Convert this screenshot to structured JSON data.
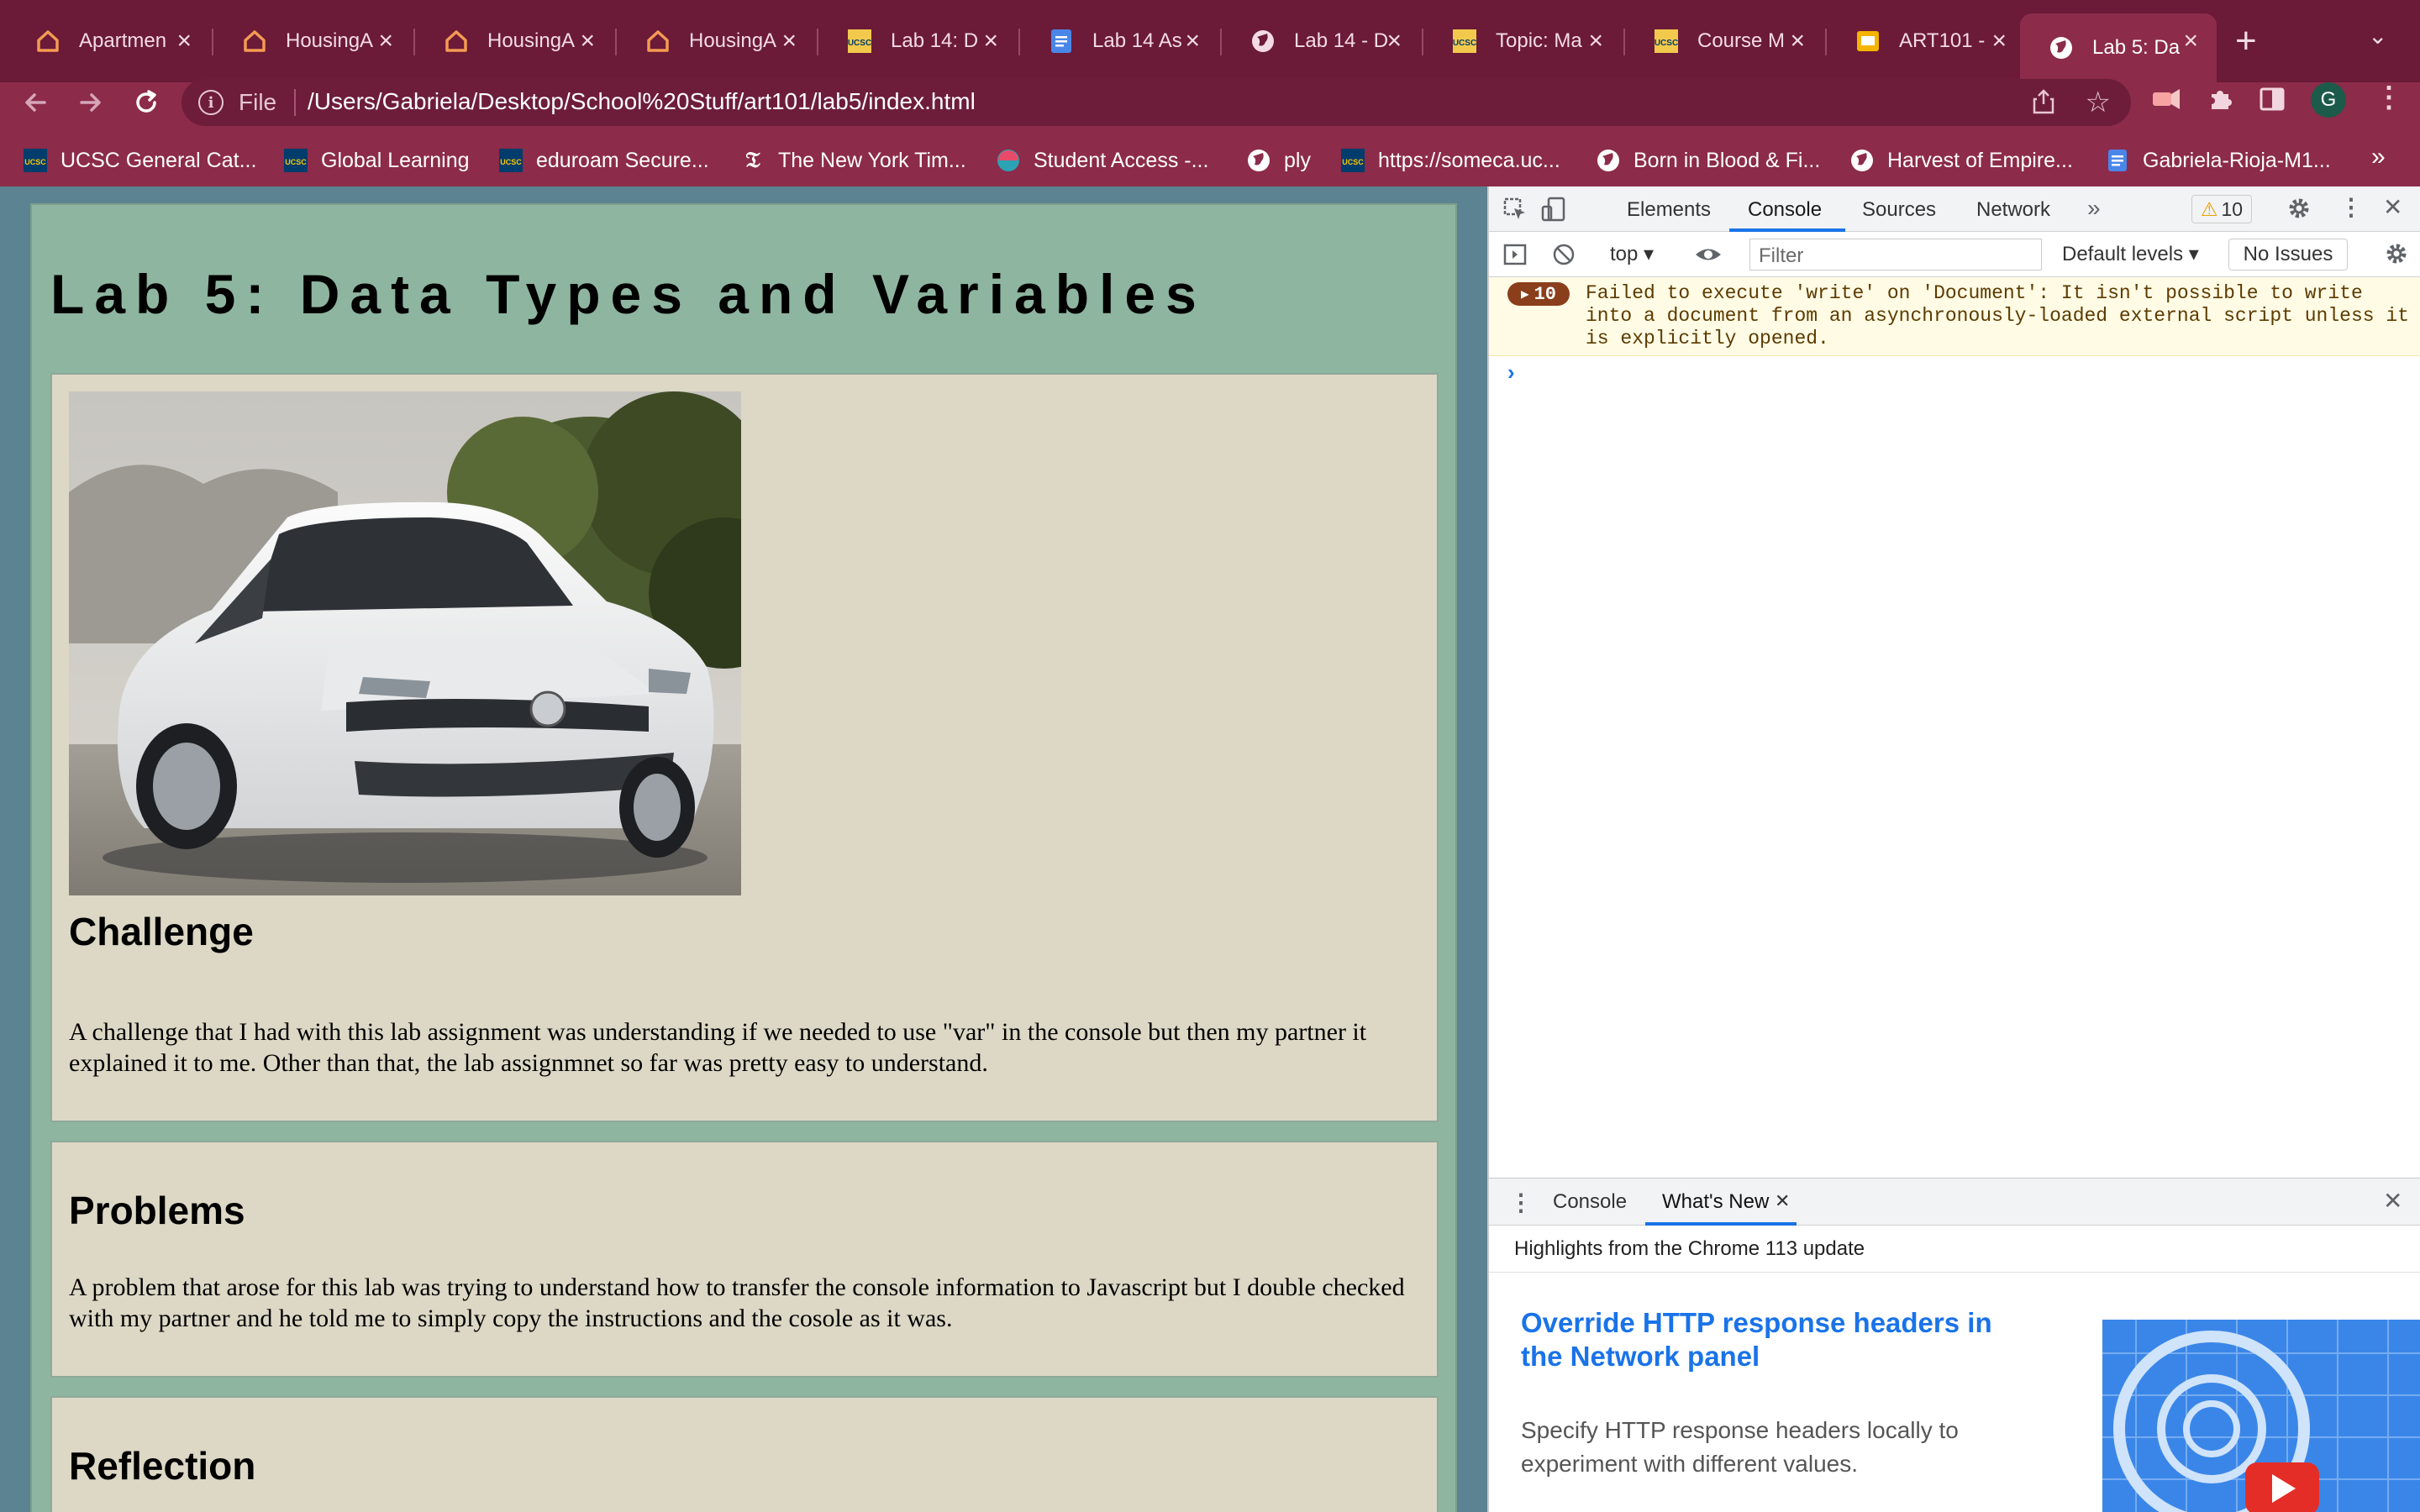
{
  "tabs": [
    {
      "label": "Apartmen",
      "icon": "home-icon"
    },
    {
      "label": "HousingA",
      "icon": "home-icon"
    },
    {
      "label": "HousingA",
      "icon": "home-icon"
    },
    {
      "label": "HousingA",
      "icon": "home-icon"
    },
    {
      "label": "Lab 14: D",
      "icon": "ucsc-icon"
    },
    {
      "label": "Lab 14 As",
      "icon": "docs-icon"
    },
    {
      "label": "Lab 14 - D",
      "icon": "globe-icon"
    },
    {
      "label": "Topic: Ma",
      "icon": "ucsc-icon"
    },
    {
      "label": "Course M",
      "icon": "ucsc-icon"
    },
    {
      "label": "ART101 -",
      "icon": "slides-icon"
    },
    {
      "label": "Lab 5: Da",
      "icon": "globe-icon",
      "active": true
    }
  ],
  "omnibox": {
    "scheme_label": "File",
    "url": "/Users/Gabriela/Desktop/School%20Stuff/art101/lab5/index.html"
  },
  "profile_initial": "G",
  "bookmarks": [
    {
      "label": "UCSC General Cat...",
      "icon": "ucsc-icon"
    },
    {
      "label": "Global Learning",
      "icon": "ucsc-icon"
    },
    {
      "label": "eduroam Secure...",
      "icon": "ucsc-icon"
    },
    {
      "label": "The New York Tim...",
      "icon": "nyt-icon"
    },
    {
      "label": "Student Access -...",
      "icon": "student-access-icon"
    },
    {
      "label": "ply",
      "icon": "globe-icon"
    },
    {
      "label": "https://someca.uc...",
      "icon": "ucsc-icon"
    },
    {
      "label": "Born in Blood & Fi...",
      "icon": "globe-icon"
    },
    {
      "label": "Harvest of Empire...",
      "icon": "globe-icon"
    },
    {
      "label": "Gabriela-Rioja-M1...",
      "icon": "docs-icon"
    }
  ],
  "page": {
    "title": "Lab 5: Data Types and Variables",
    "sections": [
      {
        "heading": "Challenge",
        "body": "A challenge that I had with this lab assignment was understanding if we needed to use \"var\" in the console but then my partner it explained it to me. Other than that, the lab assignmnet so far was pretty easy to understand."
      },
      {
        "heading": "Problems",
        "body": "A problem that arose for this lab was trying to understand how to transfer the console information to Javascript but I double checked with my partner and he told me to simply copy the instructions and the cosole as it was."
      },
      {
        "heading": "Reflection",
        "body": ""
      }
    ]
  },
  "devtools": {
    "tabs": [
      "Elements",
      "Console",
      "Sources",
      "Network"
    ],
    "active_tab": "Console",
    "warning_count": "10",
    "context": "top",
    "filter_placeholder": "Filter",
    "levels": "Default levels",
    "issues": "No Issues",
    "error": {
      "count": "10",
      "message": "Failed to execute 'write' on 'Document': It isn't possible to write into a document from an asynchronously-loaded external script unless it is explicitly opened."
    },
    "drawer": {
      "tabs": [
        "Console",
        "What's New"
      ],
      "active_tab": "What's New",
      "highlights": "Highlights from the Chrome 113 update",
      "feature_title": "Override HTTP response headers in the Network panel",
      "feature_desc": "Specify HTTP response headers locally to experiment with different values."
    }
  },
  "colors": {
    "tabbar": "#6b1a37",
    "toolbar": "#8c2b4a",
    "page_bg": "#8eb5a0",
    "card_bg": "#dcd8c5",
    "accent": "#1a73e8"
  }
}
